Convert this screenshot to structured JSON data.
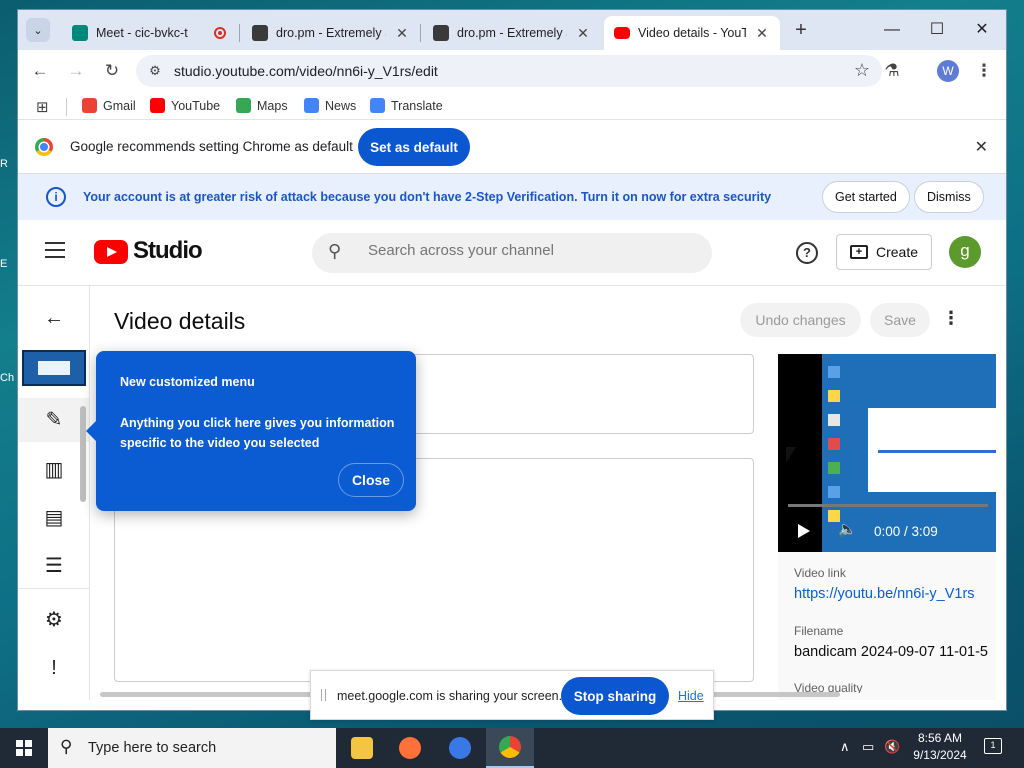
{
  "browser": {
    "tabs": [
      {
        "title": "Meet - cic-bvkc-t",
        "favicon_color": "#00897b"
      },
      {
        "title": "dro.pm - Extremely S",
        "favicon_color": "#3a3a3a"
      },
      {
        "title": "dro.pm - Extremely S",
        "favicon_color": "#3a3a3a"
      },
      {
        "title": "Video details - YouTu",
        "favicon_color": "#ff0000"
      }
    ],
    "new_tab": "+",
    "url": "studio.youtube.com/video/nn6i-y_V1rs/edit",
    "profile_initial": "W",
    "bookmarks": [
      {
        "label": "Gmail",
        "icon": "gmail-icon",
        "color": "#ea4335"
      },
      {
        "label": "YouTube",
        "icon": "youtube-icon",
        "color": "#ff0000"
      },
      {
        "label": "Maps",
        "icon": "maps-icon",
        "color": "#34a853"
      },
      {
        "label": "News",
        "icon": "news-icon",
        "color": "#4285f4"
      },
      {
        "label": "Translate",
        "icon": "translate-icon",
        "color": "#4285f4"
      }
    ],
    "default_prompt": {
      "message": "Google recommends setting Chrome as default",
      "button": "Set as default"
    }
  },
  "studio": {
    "security_banner": {
      "text": "Your account is at greater risk of attack because you don't have 2-Step Verification. Turn it on now for extra security",
      "get_started": "Get started",
      "dismiss": "Dismiss"
    },
    "logo_text": "Studio",
    "search_placeholder": "Search across your channel",
    "create_label": "Create",
    "avatar_initial": "g",
    "page_title": "Video details",
    "undo_label": "Undo changes",
    "save_label": "Save",
    "video": {
      "time": "0:00 / 3:09",
      "link_label": "Video link",
      "link": "https://youtu.be/nn6i-y_V1rs",
      "filename_label": "Filename",
      "filename": "bandicam 2024-09-07 11-01-5",
      "quality_label": "Video quality"
    },
    "popover": {
      "title": "New customized menu",
      "body": "Anything you click here gives you information specific to the video you selected",
      "close": "Close"
    }
  },
  "share_bar": {
    "text": "meet.google.com is sharing your screen.",
    "stop": "Stop sharing",
    "hide": "Hide"
  },
  "taskbar": {
    "search_placeholder": "Type here to search",
    "time": "8:56 AM",
    "date": "9/13/2024",
    "notification_count": "1"
  }
}
